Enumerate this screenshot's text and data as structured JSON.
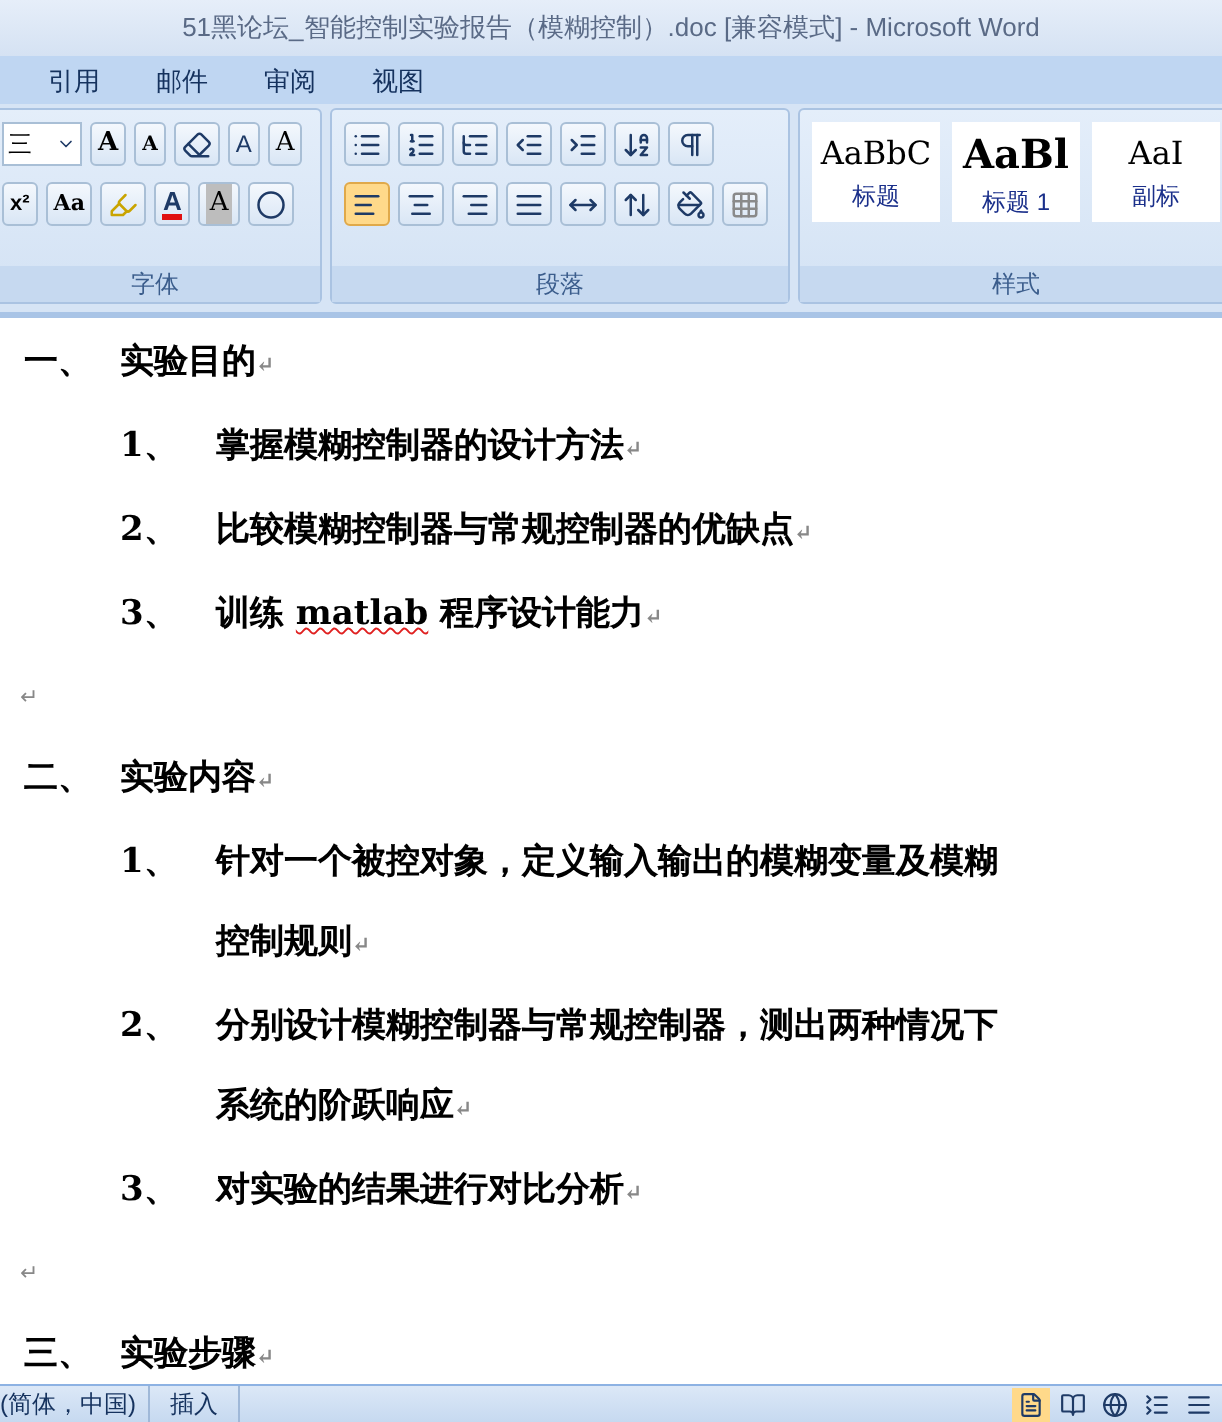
{
  "window": {
    "title": "51黑论坛_智能控制实验报告（模糊控制）.doc [兼容模式] - Microsoft Word"
  },
  "tabs": [
    {
      "label": "引用",
      "selected": false
    },
    {
      "label": "邮件",
      "selected": false
    },
    {
      "label": "审阅",
      "selected": false
    },
    {
      "label": "视图",
      "selected": false
    }
  ],
  "ribbon": {
    "font_group": {
      "label": "字体",
      "font_size": "三",
      "buttons": [
        "A",
        "A",
        "A",
        "A",
        "x²",
        "Aa",
        "A",
        "A"
      ]
    },
    "paragraph_group": {
      "label": "段落",
      "align_left_selected": true
    },
    "styles_group": {
      "label": "样式",
      "styles": [
        {
          "preview": "AaBbC",
          "name": "标题"
        },
        {
          "preview": "AaBl",
          "name": "标题 1"
        },
        {
          "preview": "AaI",
          "name": "副标"
        }
      ]
    }
  },
  "document": {
    "paragraph_mark": "↵",
    "paragraphs": [
      {
        "kind": "heading",
        "marker": "一、",
        "parts": [
          {
            "text": "实验目的"
          }
        ]
      },
      {
        "kind": "item",
        "marker": "1、",
        "parts": [
          {
            "text": "掌握模糊控制器的设计方法"
          }
        ]
      },
      {
        "kind": "item",
        "marker": "2、",
        "parts": [
          {
            "text": "比较模糊控制器与常规控制器的优缺点"
          }
        ]
      },
      {
        "kind": "item",
        "marker": "3、",
        "parts": [
          {
            "text": "训练 "
          },
          {
            "text": "matlab",
            "misspelled": true
          },
          {
            "text": " 程序设计能力"
          }
        ]
      },
      {
        "kind": "empty"
      },
      {
        "kind": "heading",
        "marker": "二、",
        "parts": [
          {
            "text": "实验内容"
          }
        ]
      },
      {
        "kind": "item",
        "marker": "1、",
        "parts": [
          {
            "text": "针对一个被控对象，定义输入输出的模糊变量及模糊控制规则"
          }
        ]
      },
      {
        "kind": "item",
        "marker": "2、",
        "parts": [
          {
            "text": "分别设计模糊控制器与常规控制器，测出两种情况下系统的阶跃响应"
          }
        ]
      },
      {
        "kind": "item",
        "marker": "3、",
        "parts": [
          {
            "text": "对实验的结果进行对比分析"
          }
        ]
      },
      {
        "kind": "empty"
      },
      {
        "kind": "heading",
        "marker": "三、",
        "parts": [
          {
            "text": "实验步骤"
          }
        ]
      }
    ]
  },
  "status_bar": {
    "language": "(简体，中国)",
    "mode": "插入",
    "views": [
      {
        "selected": true
      },
      {
        "selected": false
      },
      {
        "selected": false
      },
      {
        "selected": false
      },
      {
        "selected": false
      }
    ]
  }
}
